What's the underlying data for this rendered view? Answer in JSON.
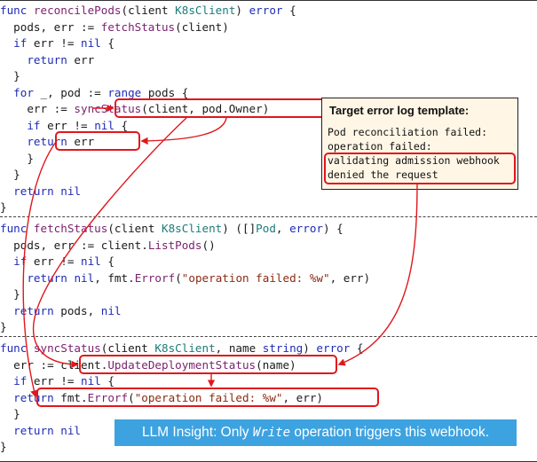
{
  "colors": {
    "highlight": "#e0171c",
    "insight_bg": "#3da2e0",
    "note_bg": "#fff6e6"
  },
  "code": {
    "reconcile": [
      "func reconcilePods(client K8sClient) error {",
      "  pods, err := fetchStatus(client)",
      "  if err != nil {",
      "    return err",
      "  }",
      "  for _, pod := range pods {",
      "    err := syncStatus(client, pod.Owner)",
      "    if err != nil {",
      "    return err",
      "    }",
      "  }",
      "  return nil",
      "}"
    ],
    "fetch": [
      "func fetchStatus(client K8sClient) ([]Pod, error) {",
      "  pods, err := client.ListPods()",
      "  if err != nil {",
      "    return nil, fmt.Errorf(\"operation failed: %w\", err)",
      "  }",
      "  return pods, nil",
      "}"
    ],
    "sync": [
      "func syncStatus(client K8sClient, name string) error {",
      "  err := client.UpdateDeploymentStatus(name)",
      "  if err != nil {",
      "    return fmt.Errorf(\"operation failed: %w\", err)",
      "  }",
      "  return nil",
      "}"
    ]
  },
  "note": {
    "title": "Target error log template:",
    "lines": [
      "Pod reconciliation failed:",
      "operation failed:",
      "validating admission webhook",
      "denied the request"
    ]
  },
  "insight": {
    "prefix": "LLM Insight: Only ",
    "keyword": "Write",
    "suffix": " operation triggers this webhook."
  }
}
